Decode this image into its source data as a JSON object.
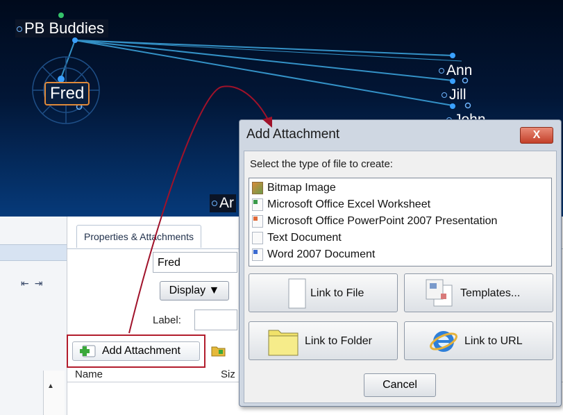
{
  "map": {
    "root_node": "PB Buddies",
    "selected_node": "Fred",
    "nodes": [
      "Ann",
      "Jill",
      "John"
    ],
    "partial_node": "Ar"
  },
  "panel": {
    "tab_label": "Properties & Attachments",
    "name_value": "Fred",
    "display_button": "Display ▼",
    "label_label": "Label:",
    "add_attachment_button": "Add Attachment",
    "columns": {
      "name": "Name",
      "size": "Siz"
    }
  },
  "dialog": {
    "title": "Add Attachment",
    "close_label": "X",
    "prompt": "Select the type of file to create:",
    "file_types": [
      "Bitmap Image",
      "Microsoft Office Excel Worksheet",
      "Microsoft Office PowerPoint 2007 Presentation",
      "Text Document",
      "Word 2007 Document"
    ],
    "buttons": {
      "link_file": "Link to File",
      "templates": "Templates...",
      "link_folder": "Link to Folder",
      "link_url": "Link to URL",
      "cancel": "Cancel"
    }
  },
  "colors": {
    "highlight_border": "#b21c2c",
    "annotation_arrow": "#a0122a",
    "map_link": "#3aa0d8",
    "selected_node_border": "#e08a3a"
  }
}
